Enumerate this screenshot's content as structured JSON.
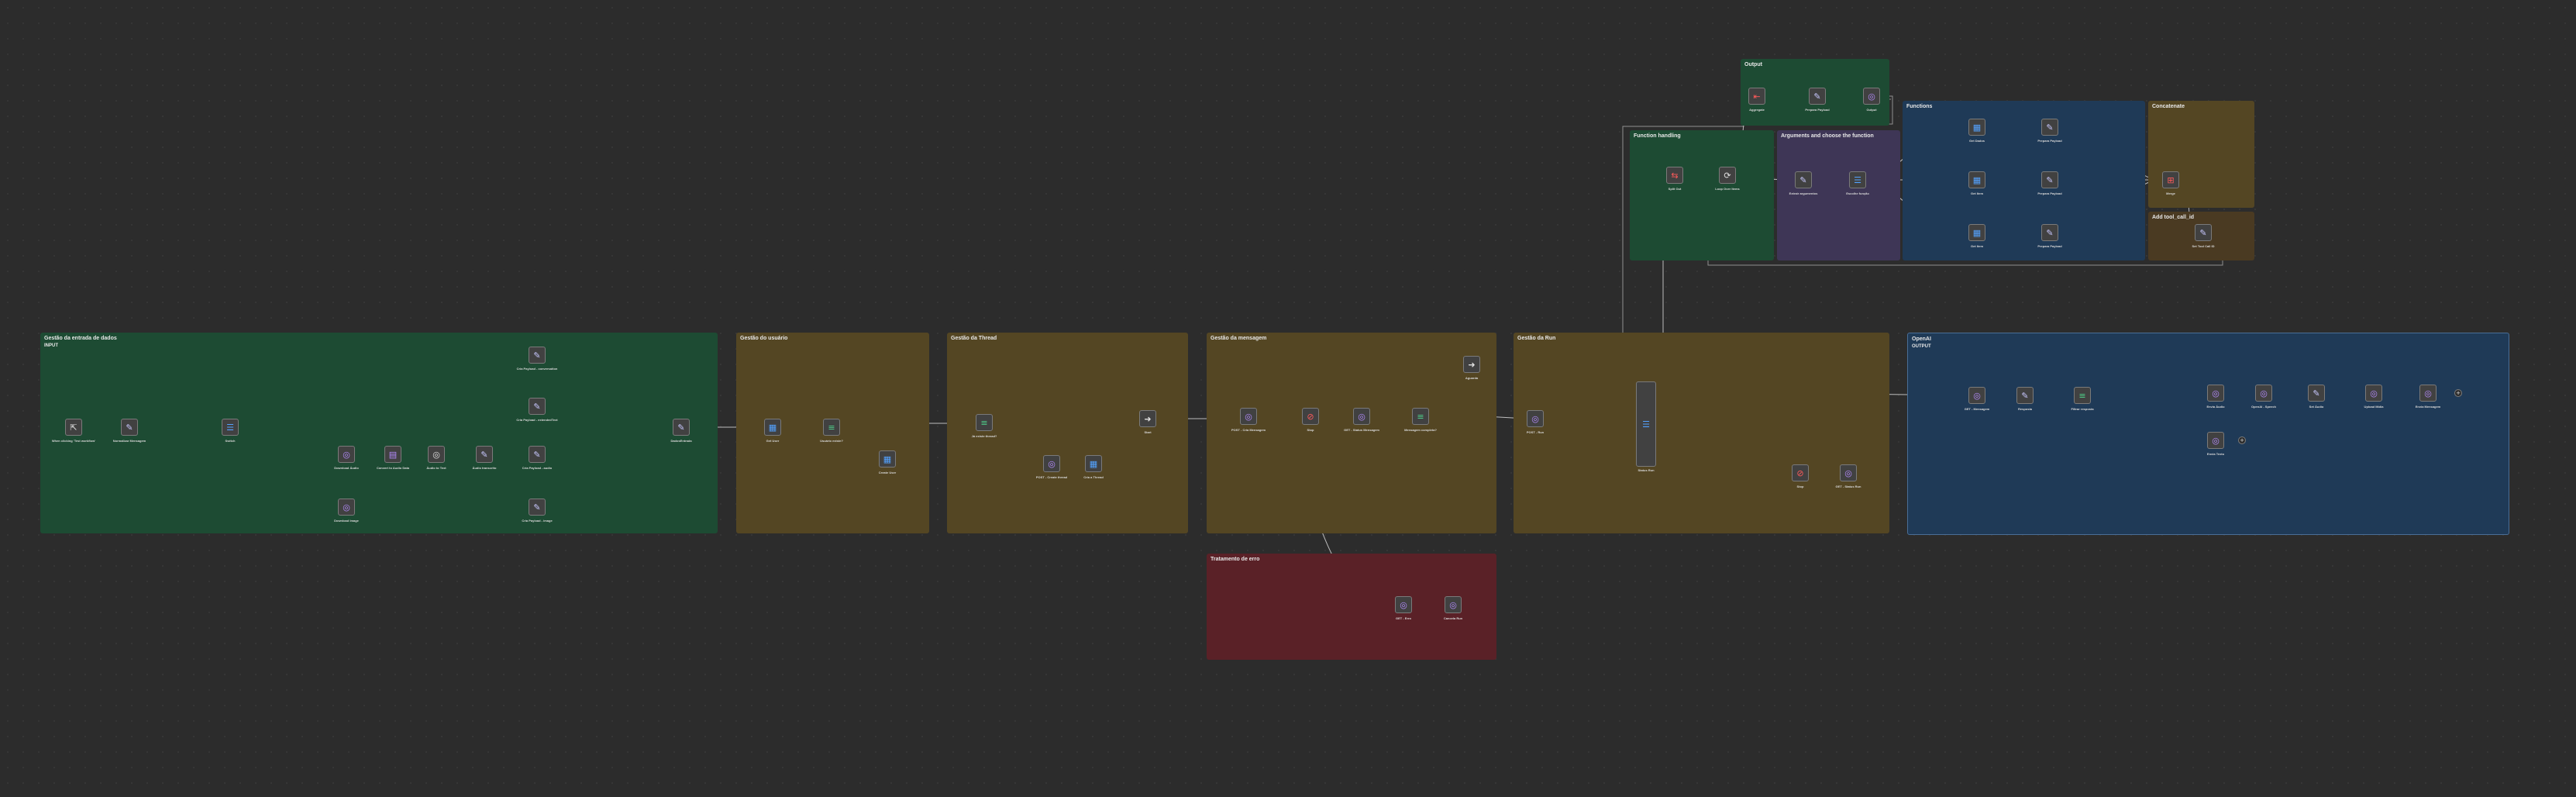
{
  "groups": {
    "entrada": {
      "title": "Gestão da entrada de dados",
      "subtitle": "INPUT"
    },
    "usuario": {
      "title": "Gestão do usuário"
    },
    "thread": {
      "title": "Gestão da Thread"
    },
    "mensagem": {
      "title": "Gestão da mensagem"
    },
    "run": {
      "title": "Gestão da Run"
    },
    "openai": {
      "title": "OpenAI",
      "subtitle": "OUTPUT"
    },
    "erro": {
      "title": "Tratamento de erro"
    },
    "output": {
      "title": "Output"
    },
    "function_handling": {
      "title": "Function handling"
    },
    "arguments": {
      "title": "Arguments and choose the function"
    },
    "functions": {
      "title": "Functions"
    },
    "concatenate": {
      "title": "Concatenate"
    },
    "add_tool": {
      "title": "Add tool_call_id"
    }
  },
  "nodes": {
    "webhook": {
      "label": "When clicking 'Test workflow'",
      "icon": "cursor-icon"
    },
    "normalizar": {
      "label": "Normalizar Mensagem",
      "icon": "pencil-icon"
    },
    "switch": {
      "label": "Switch",
      "icon": "switch-icon"
    },
    "download_audio": {
      "label": "Download Áudio",
      "icon": "http-icon"
    },
    "convert_audio": {
      "label": "Convert to Audio Data",
      "icon": "file-icon"
    },
    "audio_text": {
      "label": "Áudio to Text",
      "icon": "http-icon"
    },
    "audio_transcrito": {
      "label": "Áudio transcrito",
      "icon": "pencil-icon"
    },
    "download_image": {
      "label": "Download Image",
      "icon": "http-icon"
    },
    "payload_conversation": {
      "label": "Cria Payload - conversation",
      "icon": "pencil-icon"
    },
    "payload_extended": {
      "label": "Cria Payload - extendedText",
      "icon": "pencil-icon"
    },
    "payload_audio": {
      "label": "Cria Payload - audio",
      "icon": "pencil-icon"
    },
    "payload_image": {
      "label": "Cria Payload - image",
      "icon": "pencil-icon"
    },
    "dados_entrada": {
      "label": "DadosEntrada",
      "icon": "pencil-icon"
    },
    "get_user": {
      "label": "Get User",
      "icon": "db-icon"
    },
    "usuario_existe": {
      "label": "Usuário existe?",
      "icon": "filter-icon"
    },
    "create_user": {
      "label": "Create User",
      "icon": "db-icon"
    },
    "existe_thread": {
      "label": "Já existe thread?",
      "icon": "filter-icon"
    },
    "create_thread": {
      "label": "POST - Create thread",
      "icon": "http-icon"
    },
    "cria_thread": {
      "label": "Cria a Thread",
      "icon": "db-icon"
    },
    "continue_thread": {
      "label": "Start",
      "icon": "arrow-icon"
    },
    "post_message": {
      "label": "POST - Cria Mensagem",
      "icon": "http-icon"
    },
    "stop_error": {
      "label": "Stop",
      "icon": "stop-icon"
    },
    "get_status_message": {
      "label": "GET - Status Mensagem",
      "icon": "http-icon"
    },
    "mensagem_completa": {
      "label": "Mensagem completa?",
      "icon": "filter-icon"
    },
    "aguarda": {
      "label": "Aguarda",
      "icon": "arrow-icon"
    },
    "post_run": {
      "label": "POST - Run",
      "icon": "http-icon"
    },
    "status_run": {
      "label": "Status Run",
      "icon": "switch-icon"
    },
    "stop_run": {
      "label": "Stop",
      "icon": "stop-icon"
    },
    "get_run": {
      "label": "GET - Status Run",
      "icon": "http-icon"
    },
    "get_messages": {
      "label": "GET - Mensagem",
      "icon": "http-icon"
    },
    "set_resposta": {
      "label": "Resposta",
      "icon": "pencil-icon"
    },
    "filter_resposta": {
      "label": "Filtrar resposta",
      "icon": "filter-icon"
    },
    "envia_audio": {
      "label": "Envia Áudio",
      "icon": "http-icon"
    },
    "openai_speech": {
      "label": "OpenAI - Speech",
      "icon": "http-icon"
    },
    "set_audio": {
      "label": "Set Áudio",
      "icon": "pencil-icon"
    },
    "upload_media": {
      "label": "Upload Mídia",
      "icon": "http-icon"
    },
    "envia_mensagem": {
      "label": "Envia Mensagem",
      "icon": "http-icon"
    },
    "mensagem_final": {
      "label": "Mensagem final",
      "icon": "http-icon"
    },
    "envia_texto": {
      "label": "Envia Texto",
      "icon": "http-icon"
    },
    "erro_get": {
      "label": "GET - Erro",
      "icon": "http-icon"
    },
    "erro_cancel": {
      "label": "Cancela Run",
      "icon": "http-icon"
    },
    "split_out": {
      "label": "Split Out",
      "icon": "split-icon"
    },
    "loop_items": {
      "label": "Loop Over Items",
      "icon": "loop-icon"
    },
    "aggregate": {
      "label": "Aggregate",
      "icon": "aggregate-icon"
    },
    "prepara_payload_out": {
      "label": "Prepara Payload",
      "icon": "pencil-icon"
    },
    "submit_output": {
      "label": "Output",
      "icon": "http-icon"
    },
    "extrai_args": {
      "label": "Extrair argumentos",
      "icon": "pencil-icon"
    },
    "escolhe_funcao": {
      "label": "Escolhe função",
      "icon": "switch-icon"
    },
    "fn_get_1": {
      "label": "Get Dados",
      "icon": "db-icon"
    },
    "fn_payload_1": {
      "label": "Prepara Payload",
      "icon": "pencil-icon"
    },
    "fn_get_2": {
      "label": "Get Item",
      "icon": "db-icon"
    },
    "fn_payload_2": {
      "label": "Prepara Payload",
      "icon": "pencil-icon"
    },
    "fn_get_3": {
      "label": "Get Item",
      "icon": "db-icon"
    },
    "fn_payload_3": {
      "label": "Prepara Payload",
      "icon": "pencil-icon"
    },
    "merge": {
      "label": "Merge",
      "icon": "merge-icon"
    },
    "set_tool_id": {
      "label": "Set Tool Call ID",
      "icon": "pencil-icon"
    }
  }
}
